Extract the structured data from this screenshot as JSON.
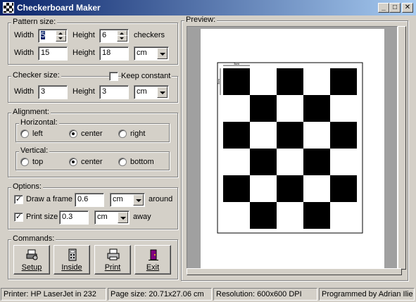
{
  "window": {
    "title": "Checkerboard Maker",
    "min_glyph": "_",
    "max_glyph": "□",
    "close_glyph": "✕"
  },
  "pattern": {
    "legend": "Pattern size:",
    "width_label": "Width",
    "width_value": "5",
    "height_label": "Height",
    "height_value": "6",
    "checkers_label": "checkers",
    "width2_label": "Width",
    "width2_value": "15",
    "height2_label": "Height",
    "height2_value": "18",
    "unit": "cm"
  },
  "checker": {
    "legend": "Checker size:",
    "keep_constant_label": "Keep constant",
    "keep_constant": false,
    "width_label": "Width",
    "width_value": "3",
    "height_label": "Height",
    "height_value": "3",
    "unit": "cm"
  },
  "alignment": {
    "legend": "Alignment:",
    "horizontal_legend": "Horizontal:",
    "h_options": [
      "left",
      "center",
      "right"
    ],
    "h_selected": "center",
    "vertical_legend": "Vertical:",
    "v_options": [
      "top",
      "center",
      "bottom"
    ],
    "v_selected": "center"
  },
  "options": {
    "legend": "Options:",
    "frame_label": "Draw a frame",
    "frame_checked": true,
    "frame_value": "0.6",
    "frame_unit": "cm",
    "frame_suffix": "around",
    "print_size_label": "Print size",
    "print_size_checked": true,
    "print_size_value": "0.3",
    "print_size_unit": "cm",
    "print_size_suffix": "away"
  },
  "commands": {
    "legend": "Commands:",
    "buttons": [
      {
        "label": "Setup",
        "icon": "printer-setup-icon"
      },
      {
        "label": "Inside",
        "icon": "calculator-icon"
      },
      {
        "label": "Print",
        "icon": "printer-icon"
      },
      {
        "label": "Exit",
        "icon": "exit-door-icon"
      }
    ]
  },
  "preview": {
    "legend": "Preview:",
    "columns": 5,
    "rows": 6,
    "dimension_label_top": "3cm",
    "dimension_label_left": "3cm"
  },
  "status": {
    "printer": "Printer: HP LaserJet in 232",
    "page_size": "Page size: 20.71x27.06 cm",
    "resolution": "Resolution: 600x600 DPI",
    "credit": "Programmed by Adrian Ilie"
  },
  "colors": {
    "title_start": "#0a246a",
    "title_end": "#a6caf0",
    "face": "#d4d0c8"
  }
}
